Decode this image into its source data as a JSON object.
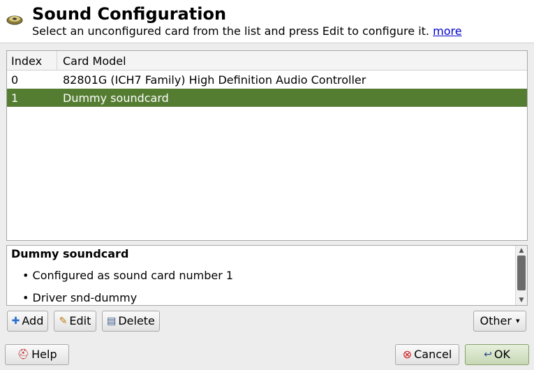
{
  "header": {
    "title": "Sound Configuration",
    "subtitle": "Select an unconfigured card from the list and press Edit to configure it.",
    "more_link": "more",
    "icon": "speaker-icon"
  },
  "table": {
    "columns": [
      "Index",
      "Card Model"
    ],
    "rows": [
      {
        "index": "0",
        "model": "82801G (ICH7 Family) High Definition Audio Controller",
        "selected": false
      },
      {
        "index": "1",
        "model": "Dummy soundcard",
        "selected": true
      }
    ]
  },
  "description": {
    "title": "Dummy soundcard",
    "bullets": [
      "• Configured as sound card number 1",
      "• Driver snd-dummy"
    ]
  },
  "actions": {
    "add": "Add",
    "edit": "Edit",
    "delete": "Delete",
    "other": "Other"
  },
  "footer": {
    "help": "Help",
    "cancel": "Cancel",
    "ok": "OK"
  },
  "colors": {
    "selection": "#557d32",
    "link": "#0000cc"
  }
}
